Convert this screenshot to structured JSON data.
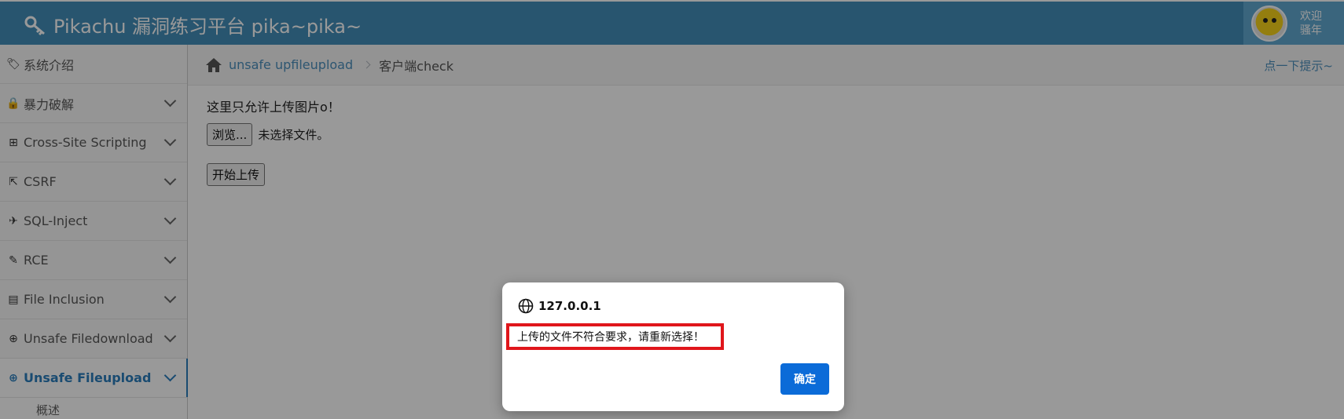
{
  "header": {
    "title": "Pikachu 漏洞练习平台 pika~pika~",
    "welcome_line1": "欢迎",
    "welcome_line2": "骚年"
  },
  "sidebar": {
    "items": [
      {
        "label": "系统介绍",
        "icon": "tags-icon",
        "glyph": "🏷",
        "has_chevron": false
      },
      {
        "label": "暴力破解",
        "icon": "lock-icon",
        "glyph": "🔒",
        "has_chevron": true
      },
      {
        "label": "Cross-Site Scripting",
        "icon": "sitemap-icon",
        "glyph": "⊞",
        "has_chevron": true
      },
      {
        "label": "CSRF",
        "icon": "share-square-icon",
        "glyph": "⇱",
        "has_chevron": true
      },
      {
        "label": "SQL-Inject",
        "icon": "plane-icon",
        "glyph": "✈",
        "has_chevron": true
      },
      {
        "label": "RCE",
        "icon": "pencil-icon",
        "glyph": "✎",
        "has_chevron": true
      },
      {
        "label": "File Inclusion",
        "icon": "file-icon",
        "glyph": "▤",
        "has_chevron": true
      },
      {
        "label": "Unsafe Filedownload",
        "icon": "download-circle-icon",
        "glyph": "⊕",
        "has_chevron": true
      },
      {
        "label": "Unsafe Fileupload",
        "icon": "upload-circle-icon",
        "glyph": "⊕",
        "has_chevron": true,
        "active": true
      }
    ],
    "sub_items": [
      "概述"
    ]
  },
  "breadcrumb": {
    "link": "unsafe upfileupload",
    "current": "客户端check",
    "hint": "点一下提示~"
  },
  "main": {
    "notice": "这里只允许上传图片o！",
    "browse_label": "浏览...",
    "file_status": "未选择文件。",
    "upload_label": "开始上传"
  },
  "dialog": {
    "origin": "127.0.0.1",
    "message": "上传的文件不符合要求，请重新选择！",
    "ok_label": "确定"
  },
  "colors": {
    "header": "#438eb9",
    "accent": "#2b7dbc",
    "dialog_button": "#0b6bd8",
    "highlight_border": "#e0161b"
  }
}
